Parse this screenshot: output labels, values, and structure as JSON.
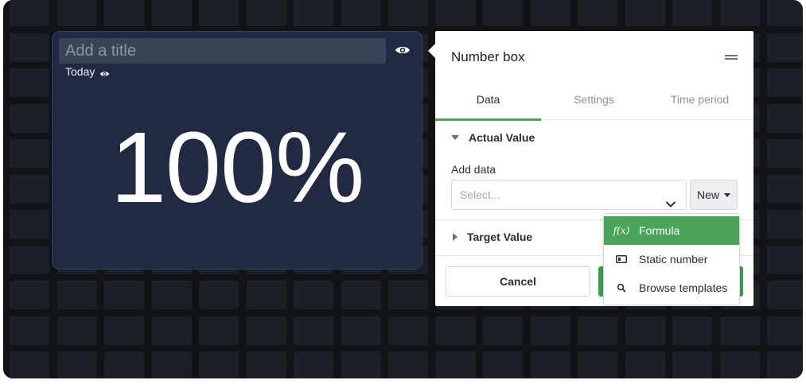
{
  "widget": {
    "title_placeholder": "Add a title",
    "period_label": "Today",
    "value": "100%"
  },
  "panel": {
    "title": "Number box",
    "tabs": [
      {
        "label": "Data",
        "active": true
      },
      {
        "label": "Settings",
        "active": false
      },
      {
        "label": "Time period",
        "active": false
      }
    ],
    "actual_value": {
      "heading": "Actual Value",
      "add_data_label": "Add data",
      "select_placeholder": "Select...",
      "new_button_label": "New"
    },
    "target_value": {
      "heading": "Target Value"
    },
    "cancel_label": "Cancel"
  },
  "new_menu": {
    "items": [
      {
        "label": "Formula",
        "icon": "formula-icon",
        "icon_glyph": "f(x)",
        "highlighted": true
      },
      {
        "label": "Static number",
        "icon": "number-box-icon",
        "highlighted": false
      },
      {
        "label": "Browse templates",
        "icon": "search-icon",
        "highlighted": false
      }
    ]
  },
  "colors": {
    "canvas_bg": "#111317",
    "grid_cell": "#1c1f26",
    "widget_bg": "#212a42",
    "accent_green": "#4aa45a"
  }
}
